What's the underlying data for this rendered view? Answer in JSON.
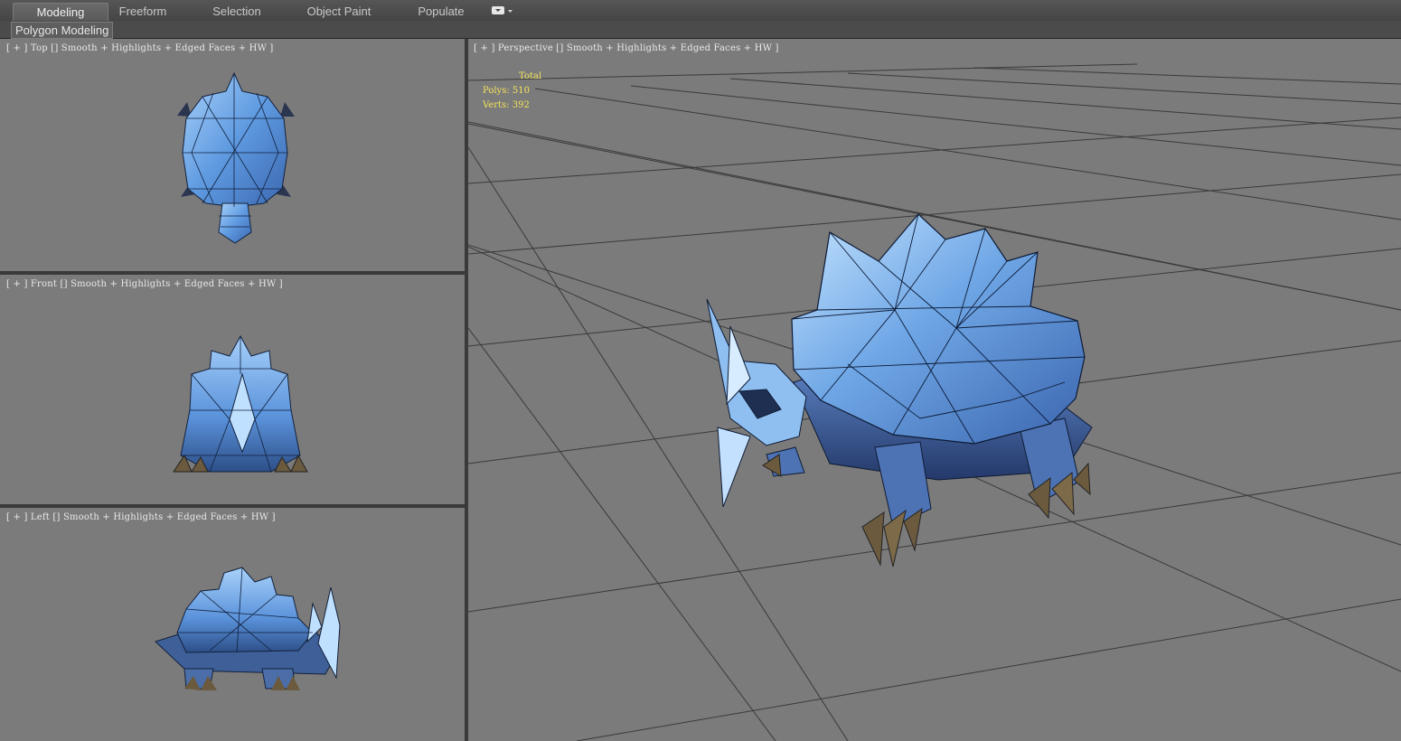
{
  "ribbon": {
    "tabs": [
      {
        "label": "Modeling",
        "active": true
      },
      {
        "label": "Freeform",
        "active": false
      },
      {
        "label": "Selection",
        "active": false
      },
      {
        "label": "Object Paint",
        "active": false
      },
      {
        "label": "Populate",
        "active": false
      }
    ],
    "panel_label": "Polygon Modeling"
  },
  "viewports": {
    "top": {
      "label": "[ + ] Top [] Smooth + Highlights + Edged Faces + HW ]"
    },
    "front": {
      "label": "[ + ] Front [] Smooth + Highlights + Edged Faces + HW ]"
    },
    "left": {
      "label": "[ + ] Left [] Smooth + Highlights + Edged Faces + HW ]"
    },
    "perspective": {
      "label": "[ + ] Perspective [] Smooth + Highlights + Edged Faces + HW ]",
      "stats": {
        "header": "Total",
        "polys_label": "Polys:",
        "polys": "510",
        "verts_label": "Verts:",
        "verts": "392"
      }
    }
  },
  "colors": {
    "viewport_bg": "#7b7b7b",
    "grid_line": "#3a3a3a",
    "stats_text": "#f3e35a",
    "model_ice": "#6fa7e6",
    "model_dark": "#2f4f86",
    "claws": "#6b5a3e"
  }
}
